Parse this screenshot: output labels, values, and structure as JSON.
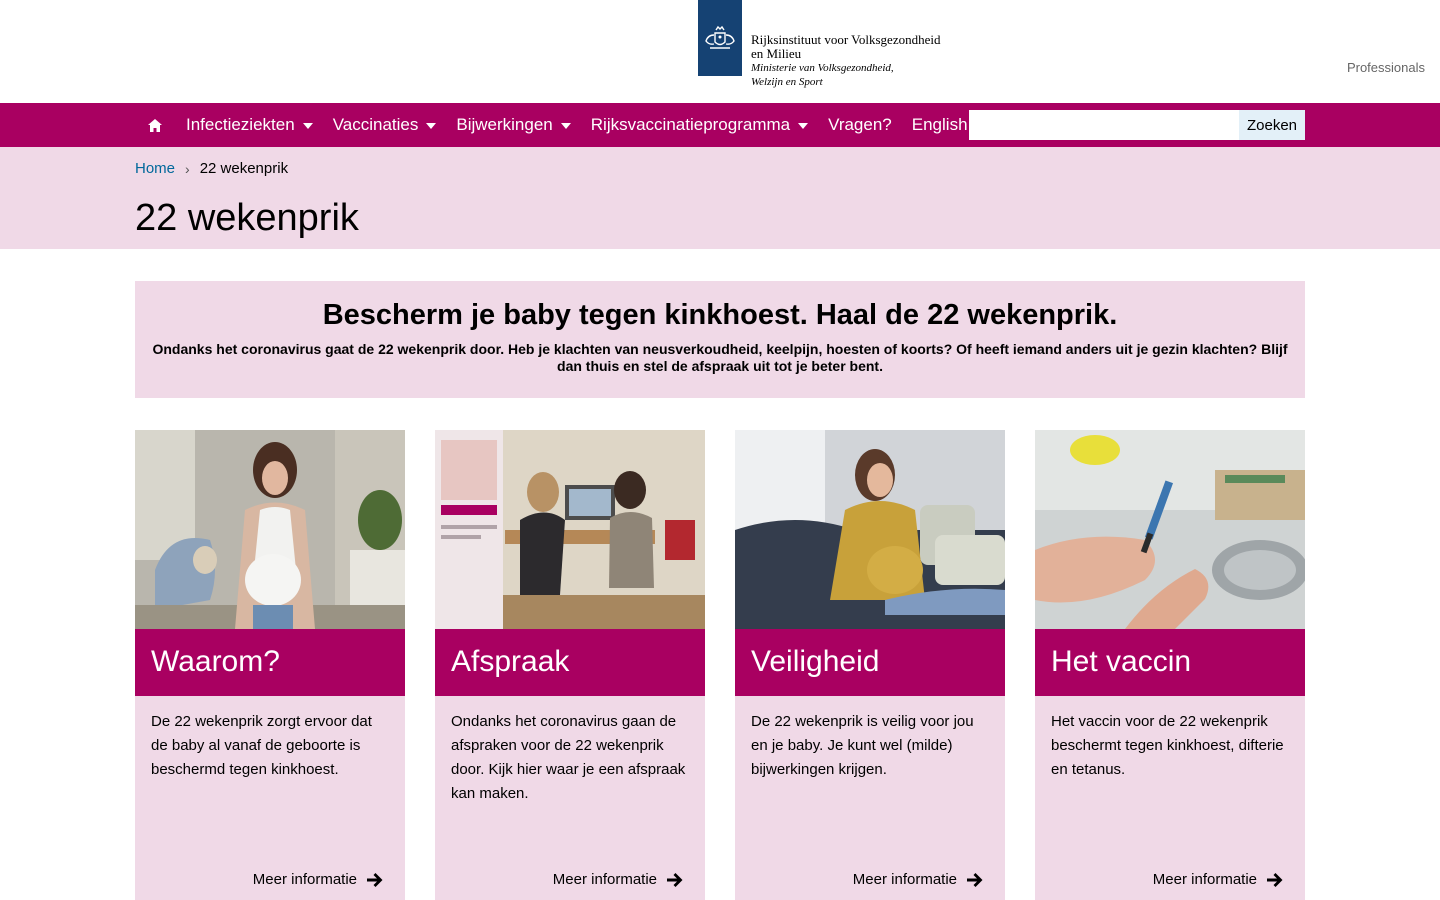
{
  "header": {
    "org_line1": "Rijksinstituut voor Volksgezondheid",
    "org_line2": "en Milieu",
    "ministry_line1": "Ministerie van Volksgezondheid,",
    "ministry_line2": "Welzijn en Sport",
    "professionals_link": "Professionals",
    "brand_color": "#154273"
  },
  "nav": {
    "accent": "#a90061",
    "home_icon": "home-icon",
    "items": [
      {
        "label": "Infectieziekten",
        "has_dropdown": true
      },
      {
        "label": "Vaccinaties",
        "has_dropdown": true
      },
      {
        "label": "Bijwerkingen",
        "has_dropdown": true
      },
      {
        "label": "Rijksvaccinatieprogramma",
        "has_dropdown": true
      },
      {
        "label": "Vragen?",
        "has_dropdown": false
      },
      {
        "label": "English",
        "has_dropdown": false
      }
    ],
    "search_value": "",
    "search_button": "Zoeken"
  },
  "breadcrumb": {
    "home": "Home",
    "separator": "›",
    "current": "22 wekenprik"
  },
  "page_title": "22 wekenprik",
  "banner": {
    "title": "Bescherm je baby tegen kinkhoest. Haal de 22 wekenprik.",
    "text": "Ondanks het coronavirus gaat de 22 wekenprik door. Heb je klachten van neusverkoudheid, keelpijn, hoesten of koorts? Of heeft iemand anders uit je gezin klachten? Blijf dan thuis en stel de afspraak uit tot je beter bent."
  },
  "cards": [
    {
      "title": "Waarom?",
      "text": "De 22 wekenprik zorgt ervoor dat de baby al vanaf de geboorte is beschermd tegen kinkhoest.",
      "more": "Meer informatie"
    },
    {
      "title": "Afspraak",
      "text": "Ondanks het coronavirus gaan de afspraken voor de 22 wekenprik door. Kijk hier waar je een afspraak kan maken.",
      "more": "Meer informatie"
    },
    {
      "title": "Veiligheid",
      "text": "De 22 wekenprik is veilig voor jou en je baby. Je kunt wel (milde) bijwerkingen krijgen.",
      "more": "Meer informatie"
    },
    {
      "title": "Het vaccin",
      "text": "Het vaccin voor de 22 wekenprik beschermt tegen kinkhoest, difterie en tetanus.",
      "more": "Meer informatie"
    }
  ]
}
